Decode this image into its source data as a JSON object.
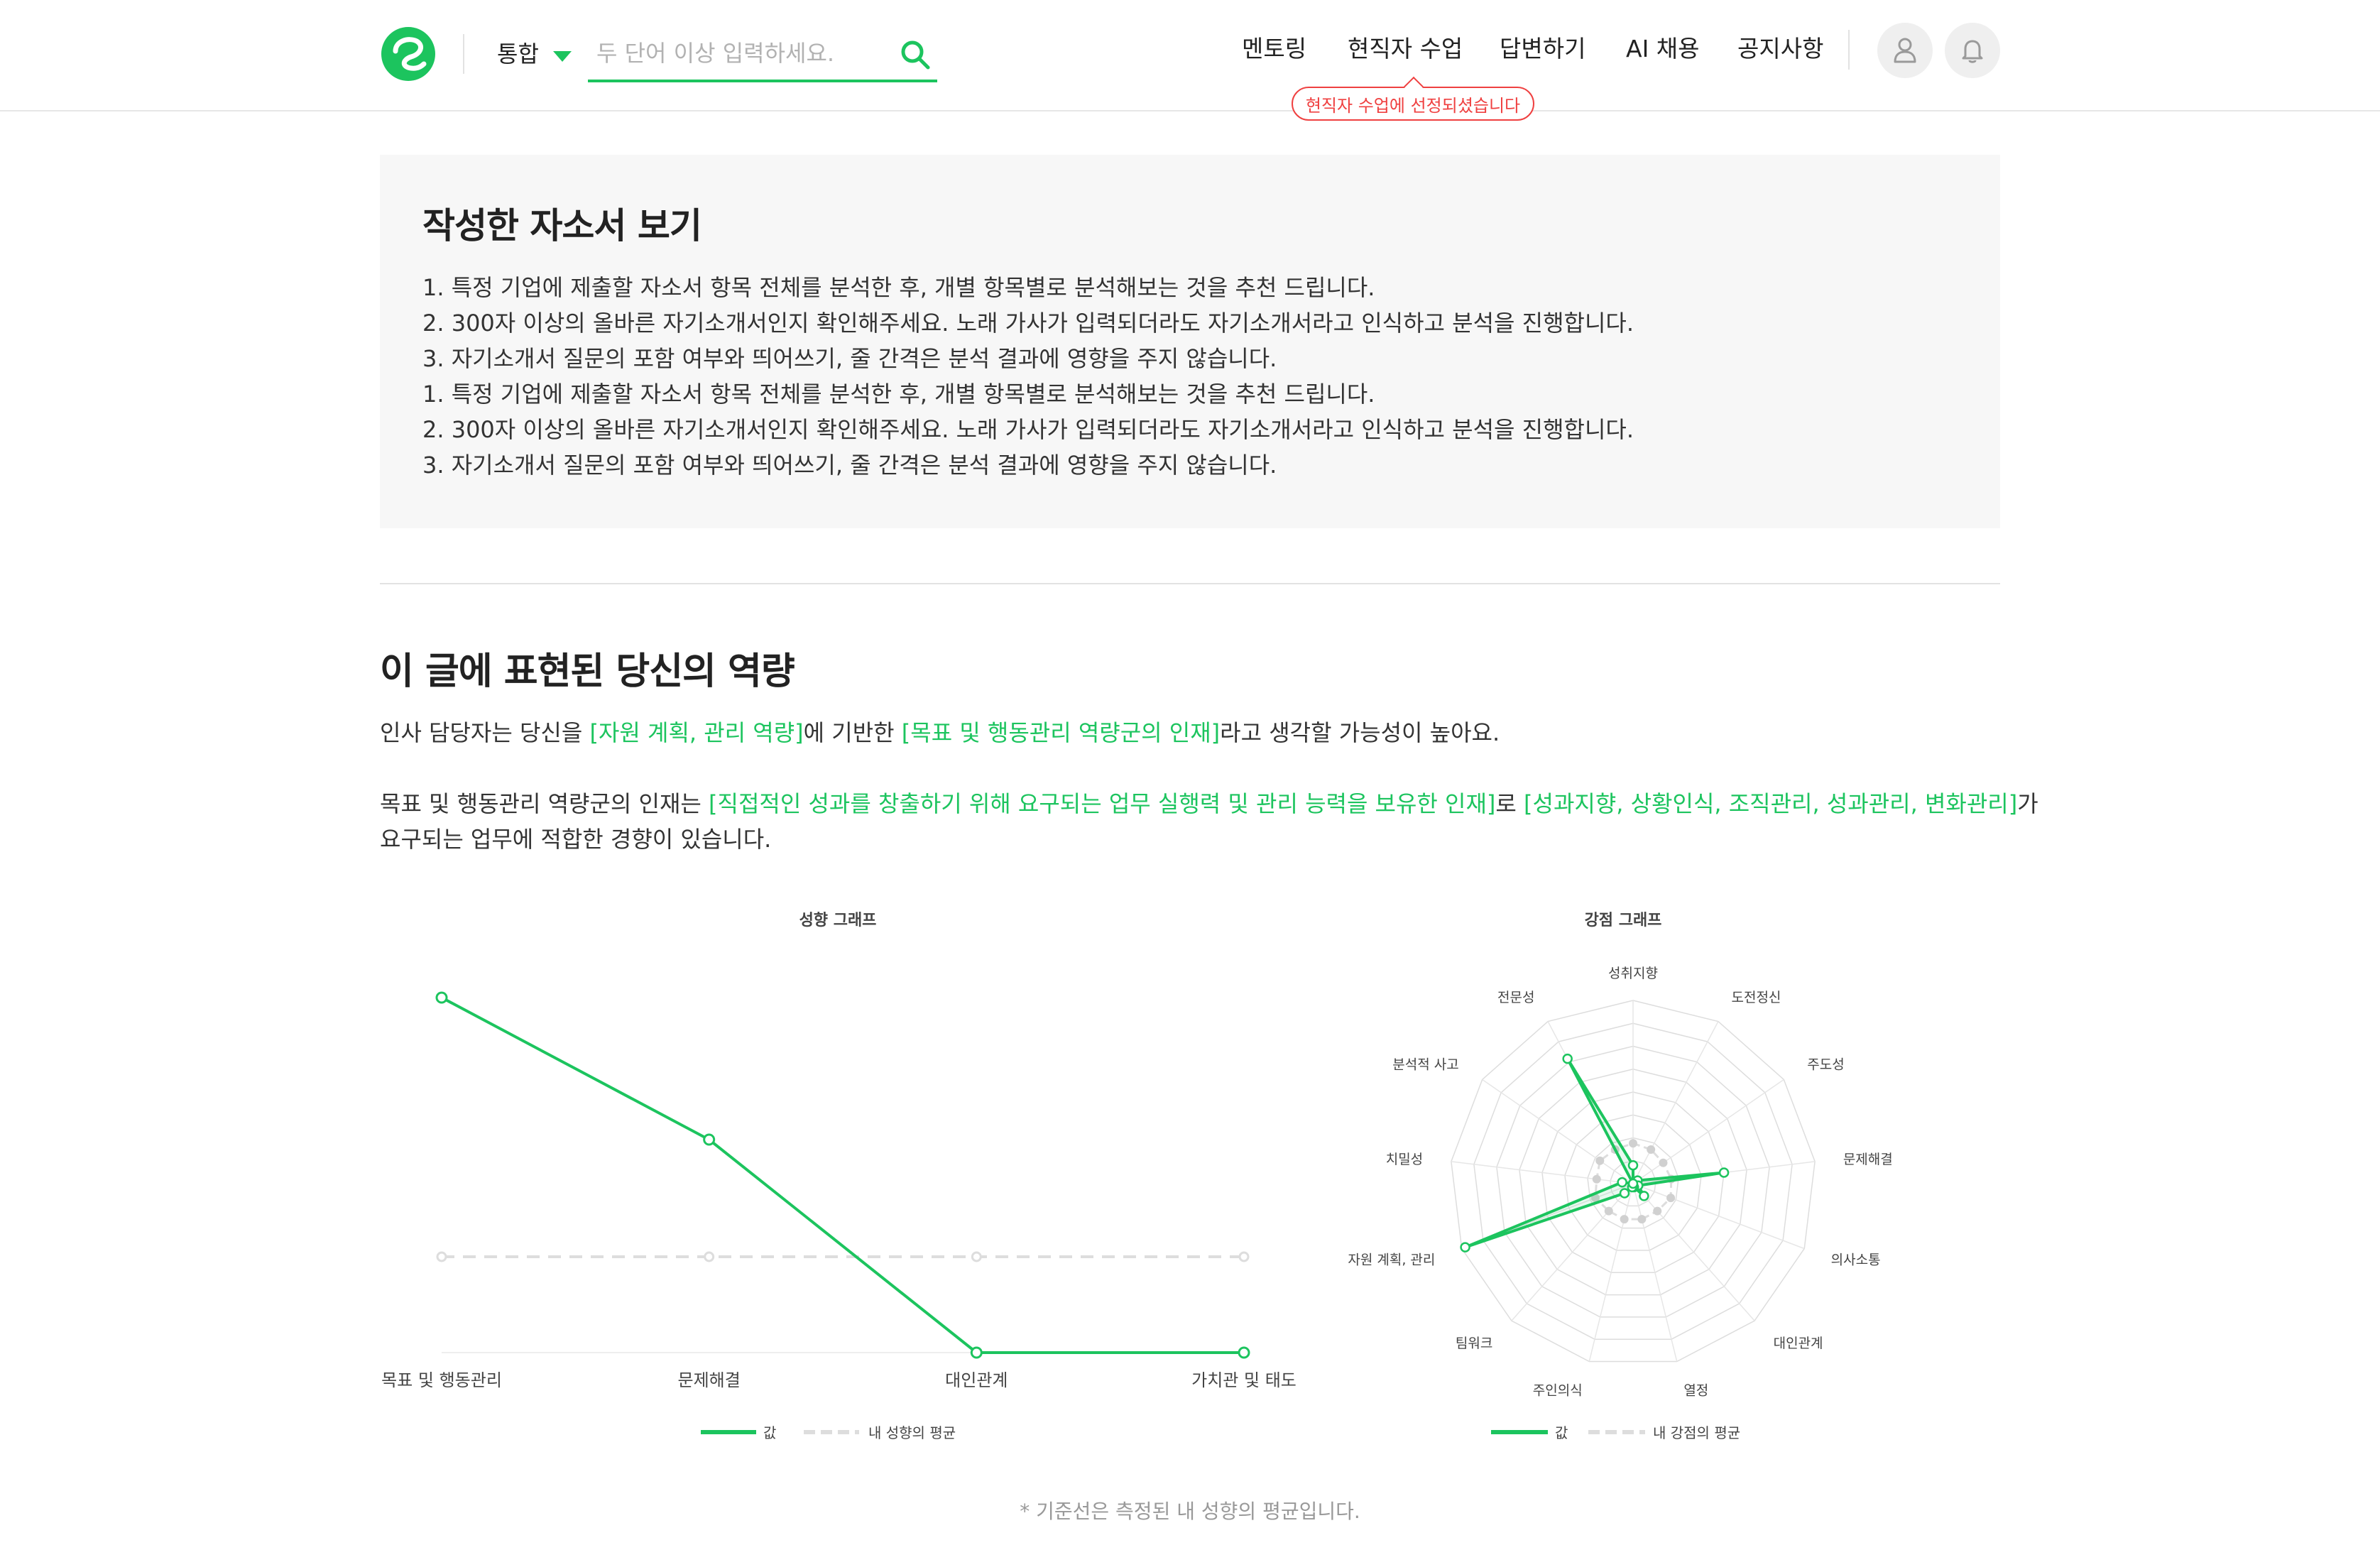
{
  "header": {
    "scope_label": "통합",
    "search_placeholder": "두 단어 이상 입력하세요.",
    "nav": [
      "멘토링",
      "현직자 수업",
      "답변하기",
      "AI 채용",
      "공지사항"
    ],
    "tooltip": "현직자 수업에 선정되셨습니다"
  },
  "info": {
    "title": "작성한 자소서 보기",
    "lines": [
      "1. 특정 기업에 제출할 자소서 항목 전체를 분석한 후, 개별 항목별로 분석해보는 것을 추천 드립니다.",
      "2. 300자 이상의 올바른 자기소개서인지 확인해주세요. 노래 가사가 입력되더라도 자기소개서라고 인식하고 분석을 진행합니다.",
      "3. 자기소개서 질문의 포함 여부와 띄어쓰기, 줄 간격은 분석 결과에 영향을 주지 않습니다.",
      "1. 특정 기업에 제출할 자소서 항목 전체를 분석한 후, 개별 항목별로 분석해보는 것을 추천 드립니다.",
      "2. 300자 이상의 올바른 자기소개서인지 확인해주세요. 노래 가사가 입력되더라도 자기소개서라고 인식하고 분석을 진행합니다.",
      "3. 자기소개서 질문의 포함 여부와 띄어쓰기, 줄 간격은 분석 결과에 영향을 주지 않습니다."
    ]
  },
  "competency": {
    "title": "이 글에 표현된 당신의 역량",
    "p1_a": "인사 담당자는 당신을 ",
    "p1_hl1": "[자원 계획, 관리 역량]",
    "p1_b": "에 기반한 ",
    "p1_hl2": "[목표 및 행동관리 역량군의 인재]",
    "p1_c": "라고 생각할 가능성이 높아요.",
    "p2_a": "목표 및 행동관리 역량군의 인재는 ",
    "p2_hl1": "[직접적인 성과를 창출하기 위해 요구되는 업무 실행력 및 관리 능력을 보유한 인재]",
    "p2_b": "로 ",
    "p2_hl2": "[성과지향, 상황인식, 조직관리, 성과관리, 변화관리]",
    "p2_c": "가",
    "p2_d": "요구되는 업무에 적합한 경향이 있습니다.",
    "footnote": "* 기준선은 측정된 내 성향의 평균입니다."
  },
  "colors": {
    "accent": "#1cc45e",
    "avg": "#dddddd",
    "alert": "#ef4040"
  },
  "chart_data": [
    {
      "type": "line",
      "title": "성향 그래프",
      "categories": [
        "목표 및 행동관리",
        "문제해결",
        "대인관계",
        "가치관 및 태도"
      ],
      "series": [
        {
          "name": "값",
          "values": [
            1.0,
            0.6,
            0.0,
            0.0
          ]
        },
        {
          "name": "내 성향의 평균",
          "values": [
            0.27,
            0.27,
            0.27,
            0.27
          ]
        }
      ],
      "ylim": [
        0,
        1
      ],
      "legend": "bottom"
    },
    {
      "type": "radar",
      "title": "강점 그래프",
      "categories": [
        "성취지향",
        "도전정신",
        "주도성",
        "문제해결",
        "의사소통",
        "대인관계",
        "열정",
        "주인의식",
        "팀워크",
        "자원 계획, 관리",
        "치밀성",
        "분석적 사고",
        "전문성"
      ],
      "series": [
        {
          "name": "값",
          "values": [
            0.1,
            0.0,
            0.03,
            0.5,
            0.03,
            0.09,
            0.02,
            0.02,
            0.07,
            0.98,
            0.06,
            0.0,
            0.77
          ]
        },
        {
          "name": "내 강점의 평균",
          "values": [
            0.22,
            0.21,
            0.2,
            0.21,
            0.22,
            0.2,
            0.2,
            0.2,
            0.2,
            0.22,
            0.2,
            0.22,
            0.21
          ]
        }
      ],
      "rlim": [
        0,
        1
      ],
      "rings": 8,
      "legend": "bottom"
    }
  ]
}
